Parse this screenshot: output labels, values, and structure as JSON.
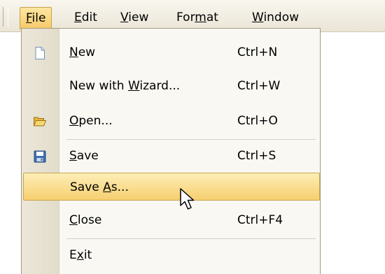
{
  "menubar": {
    "items": [
      {
        "label": "File",
        "mnemonic": "F",
        "active": true
      },
      {
        "label": "Edit",
        "mnemonic": "E",
        "active": false
      },
      {
        "label": "View",
        "mnemonic": "V",
        "active": false
      },
      {
        "label": "Format",
        "mnemonic": "m",
        "active": false
      },
      {
        "label": "Window",
        "mnemonic": "W",
        "active": false
      }
    ]
  },
  "file_menu": {
    "items": [
      {
        "label": "New",
        "mnemonic": "N",
        "shortcut": "Ctrl+N",
        "icon": "new-document-icon",
        "highlighted": false
      },
      {
        "label": "New with Wizard...",
        "mnemonic": "W",
        "shortcut": "Ctrl+W",
        "icon": "",
        "highlighted": false
      },
      {
        "label": "Open...",
        "mnemonic": "O",
        "shortcut": "Ctrl+O",
        "icon": "open-folder-icon",
        "highlighted": false
      },
      {
        "label": "Save",
        "mnemonic": "S",
        "shortcut": "Ctrl+S",
        "icon": "save-disk-icon",
        "highlighted": false
      },
      {
        "label": "Save As...",
        "mnemonic": "A",
        "shortcut": "",
        "icon": "",
        "highlighted": true
      },
      {
        "label": "Close",
        "mnemonic": "C",
        "shortcut": "Ctrl+F4",
        "icon": "",
        "highlighted": false
      },
      {
        "label": "Exit",
        "mnemonic": "x",
        "shortcut": "",
        "icon": "",
        "highlighted": false
      }
    ]
  },
  "colors": {
    "highlight": "#f6cf6f",
    "menubar_bg": "#eae5d6",
    "menu_bg": "#f9f8f3"
  }
}
